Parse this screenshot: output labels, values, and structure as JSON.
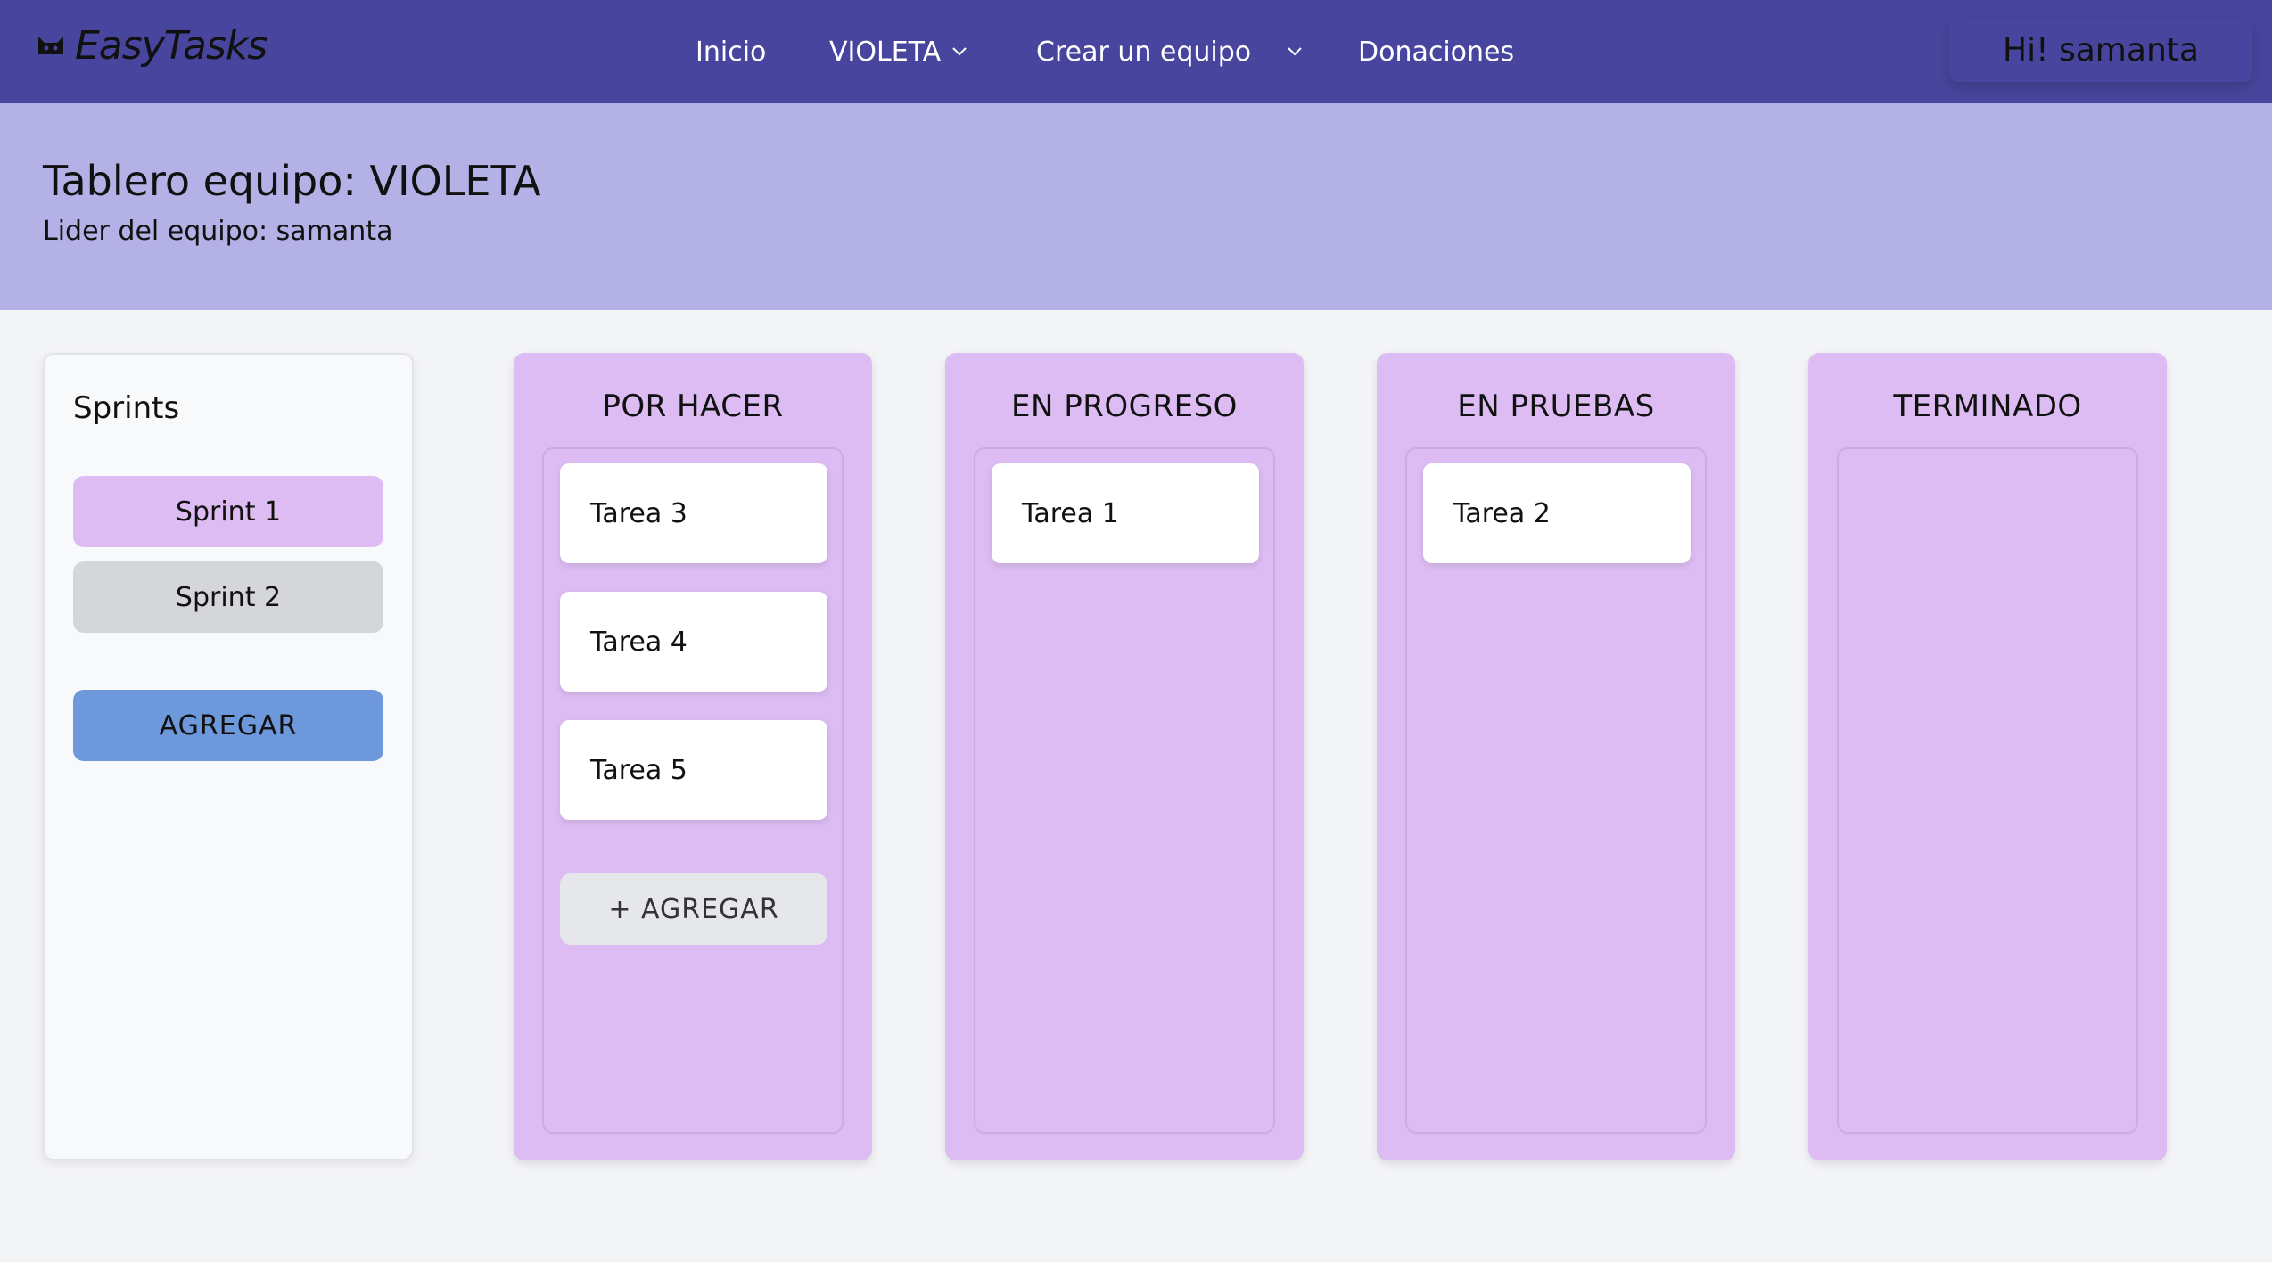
{
  "navbar": {
    "brand": "EasyTasks",
    "brand_icon": "cat-icon",
    "links": [
      {
        "label": "Inicio",
        "dropdown": false
      },
      {
        "label": "VIOLETA",
        "dropdown": true
      },
      {
        "label": "Crear un equipo",
        "dropdown": true
      },
      {
        "label": "Donaciones",
        "dropdown": false
      }
    ],
    "user_greeting": "Hi! samanta"
  },
  "header": {
    "title": "Tablero equipo: VIOLETA",
    "leader": "Lider del equipo: samanta"
  },
  "sprints": {
    "title": "Sprints",
    "items": [
      "Sprint 1",
      "Sprint 2"
    ],
    "selected": "Sprint 1",
    "add_label": "AGREGAR"
  },
  "columns": [
    {
      "title": "POR HACER",
      "tasks": [
        "Tarea 3",
        "Tarea 4",
        "Tarea 5"
      ],
      "add_label": "+ AGREGAR"
    },
    {
      "title": "EN PROGRESO",
      "tasks": [
        "Tarea 1"
      ]
    },
    {
      "title": "EN PRUEBAS",
      "tasks": [
        "Tarea 2"
      ]
    },
    {
      "title": "TERMINADO",
      "tasks": []
    }
  ],
  "colors": {
    "navbar": "#48459e",
    "header_band": "#b3b1e5",
    "column_bg": "#dcbcf2",
    "sprint_selected": "#dcbcf2",
    "sprint_unselected": "#d4d6da",
    "add_button": "#6e98dc"
  }
}
